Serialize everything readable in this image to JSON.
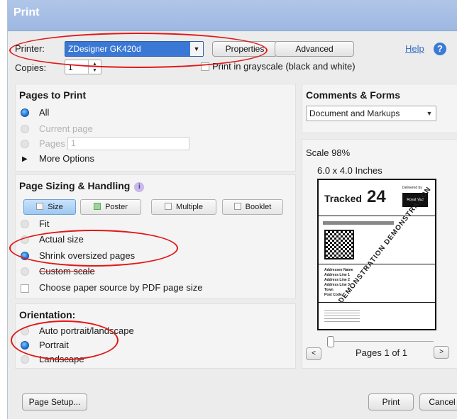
{
  "window": {
    "title": "Print"
  },
  "printer": {
    "label": "Printer:",
    "selected": "ZDesigner GK420d",
    "properties_button": "Properties",
    "advanced_button": "Advanced",
    "help_link": "Help"
  },
  "copies": {
    "label": "Copies:",
    "value": "1"
  },
  "grayscale": {
    "label": "Print in grayscale (black and white)",
    "checked": false
  },
  "pages_to_print": {
    "title": "Pages to Print",
    "options": [
      {
        "label": "All",
        "selected": true,
        "enabled": true
      },
      {
        "label": "Current page",
        "selected": false,
        "enabled": false
      },
      {
        "label": "Pages",
        "selected": false,
        "enabled": false
      }
    ],
    "pages_value": "1",
    "more_options": "More Options"
  },
  "page_sizing": {
    "title": "Page Sizing & Handling",
    "info_icon": "i",
    "tabs": [
      "Size",
      "Poster",
      "Multiple",
      "Booklet"
    ],
    "active_tab": "Size",
    "options": [
      {
        "label": "Fit",
        "selected": false,
        "enabled": false
      },
      {
        "label": "Actual size",
        "selected": false,
        "enabled": true
      },
      {
        "label": "Shrink oversized pages",
        "selected": true,
        "enabled": true
      },
      {
        "label": "Custom scale",
        "selected": false,
        "enabled": true
      }
    ],
    "paper_source": "Choose paper source by PDF page size"
  },
  "orientation": {
    "title": "Orientation:",
    "options": [
      {
        "label": "Auto portrait/landscape",
        "selected": false
      },
      {
        "label": "Portrait",
        "selected": true
      },
      {
        "label": "Landscape",
        "selected": false
      }
    ]
  },
  "comments_forms": {
    "title": "Comments & Forms",
    "selected": "Document and Markups"
  },
  "preview": {
    "scale": "Scale 98%",
    "dimensions": "6.0 x 4.0 Inches",
    "label_heading": "Tracked",
    "label_service": "24",
    "delivered_by": "Delivered by",
    "carrier": "Royal Mail",
    "watermark": "DEMONSTRATION DEMONSTRATION",
    "address_lines": [
      "Addressee Name",
      "Address Line 1",
      "Address Line 2",
      "Address Line 3",
      "Town",
      "Post Code"
    ],
    "pages_text": "Pages 1 of 1"
  },
  "footer": {
    "page_setup": "Page Setup...",
    "print": "Print",
    "cancel": "Cancel"
  },
  "colors": {
    "accent": "#1e78d8",
    "titlebar": "#9eb8e2",
    "highlight": "#e11818"
  }
}
